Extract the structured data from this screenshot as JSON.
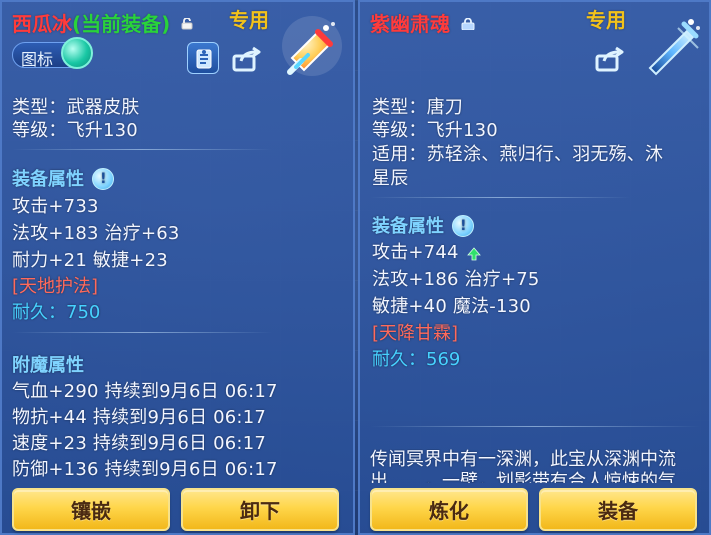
{
  "left": {
    "title_name": "西瓜冰",
    "title_status": "(当前装备)",
    "exclusive_label": "专用",
    "icon_toggle_label": "图标",
    "stats": {
      "type": "类型：武器皮肤",
      "level": "等级：飞升130"
    },
    "attributes_title": "装备属性",
    "attributes": [
      "攻击+733",
      "法攻+183 治疗+63",
      "耐力+21 敏捷+23"
    ],
    "special_skill": "[天地护法]",
    "durability": "耐久：750",
    "enchant_title": "附魔属性",
    "enchant_lines": [
      "气血+290 持续到9月6日 06:17",
      "物抗+44 持续到9月6日 06:17",
      "速度+23 持续到9月6日 06:17",
      "防御+136 持续到9月6日 06:17"
    ],
    "buttons": [
      "镶嵌",
      "卸下"
    ]
  },
  "right": {
    "title_name": "紫幽肃魂",
    "exclusive_label": "专用",
    "stats": {
      "type": "类型：唐刀",
      "level": "等级：飞升130",
      "applicable_line1": "适用：苏轻涂、燕归行、羽无殇、沐",
      "applicable_line2": "星辰"
    },
    "attributes_title": "装备属性",
    "attributes": [
      "攻击+744",
      "法攻+186 治疗+75",
      "敏捷+40 魔法-130"
    ],
    "special_skill": "[天降甘霖]",
    "durability": "耐久：569",
    "description": "传闻冥界中有一深渊，此宝从深渊中流出……，一壁，划影带有合人惊悚的气",
    "buttons": [
      "炼化",
      "装备"
    ]
  },
  "colors": {
    "title_red": "#ff3b3b",
    "status_green": "#29d33b",
    "exclusive_gold": "#f2c21b",
    "section_blue": "#7fd3ff",
    "special_red": "#ff6a5b",
    "durability_cyan": "#47d2ff",
    "button_gold": "#ffd64a"
  },
  "icons": {
    "left_lock": "unlocked-lock-icon",
    "right_lock": "locked-lock-icon",
    "share": "share-arrow-icon",
    "left_item": "watermelon-popsicle-skin-icon",
    "right_item": "blue-sword-icon",
    "attr_info": "info-exclamation-icon",
    "attr_up": "green-up-arrow-icon"
  }
}
